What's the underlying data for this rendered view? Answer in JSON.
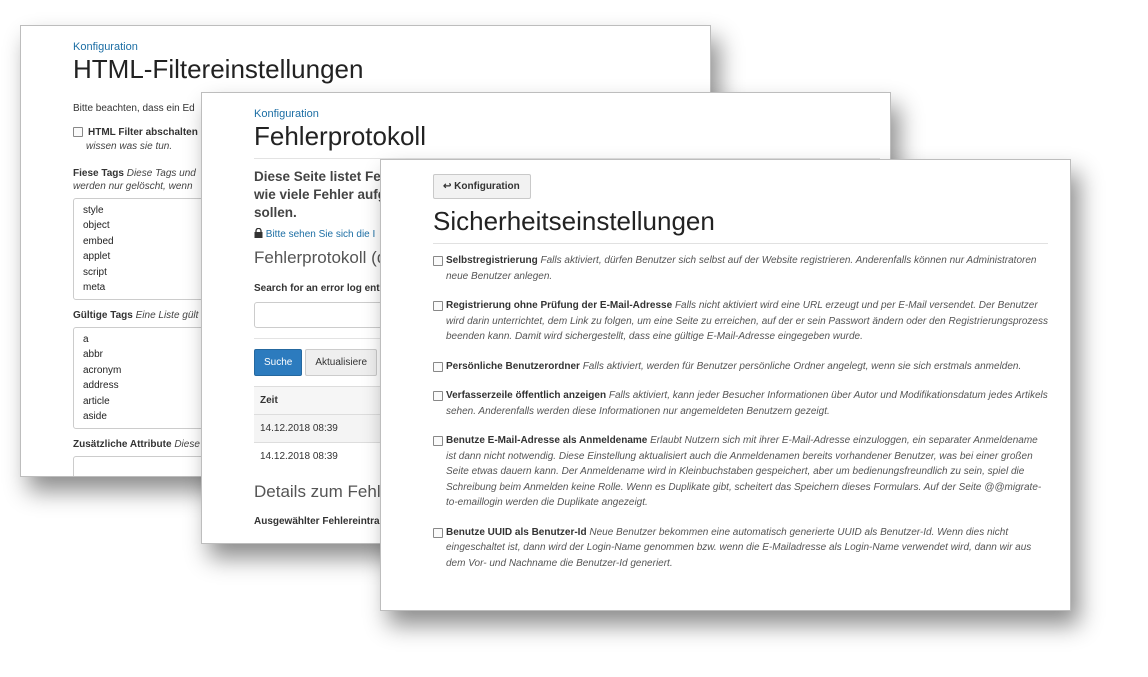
{
  "win1": {
    "breadcrumb": "Konfiguration",
    "title": "HTML-Filtereinstellungen",
    "note": "Bitte beachten, dass ein Ed",
    "disable_filter_label": "HTML Filter abschalten",
    "disable_filter_help": "wissen was sie tun.",
    "nasty_tags_label": "Fiese Tags",
    "nasty_tags_help": "Diese Tags und",
    "nasty_tags_help2": "werden nur gelöscht, wenn",
    "nasty_tags": [
      "style",
      "object",
      "embed",
      "applet",
      "script",
      "meta"
    ],
    "valid_tags_label": "Gültige Tags",
    "valid_tags_help": "Eine Liste gült",
    "valid_tags": [
      "a",
      "abbr",
      "acronym",
      "address",
      "article",
      "aside"
    ],
    "extra_attrs_label": "Zusätzliche Attribute",
    "extra_attrs_help": "Diese"
  },
  "win2": {
    "breadcrumb": "Konfiguration",
    "title": "Fehlerprotokoll",
    "intro_l1": "Diese Seite listet Feh",
    "intro_l2": "wie viele Fehler aufg",
    "intro_l3": "sollen.",
    "privacy_link": "Bitte sehen Sie sich die I",
    "section_title": "Fehlerprotokoll (di",
    "search_label": "Search for an error log ent",
    "search_button": "Suche",
    "refresh_button": "Aktualisiere",
    "table_header": "Zeit",
    "rows": [
      "14.12.2018 08:39",
      "14.12.2018 08:39"
    ],
    "details_title": "Details zum Fehler",
    "cutoff_text": "Ausgewählter Fehlereintrag"
  },
  "win3": {
    "back_button": "Konfiguration",
    "title": "Sicherheitseinstellungen",
    "settings": [
      {
        "label": "Selbstregistrierung",
        "help": "Falls aktiviert, dürfen Benutzer sich selbst auf der Website registrieren. Anderenfalls können nur Administratoren neue Benutzer anlegen."
      },
      {
        "label": "Registrierung ohne Prüfung der E-Mail-Adresse",
        "help": "Falls nicht aktiviert wird eine URL erzeugt und per E-Mail versendet. Der Benutzer wird darin unterrichtet, dem Link zu folgen, um eine Seite zu erreichen, auf der er sein Passwort ändern oder den Registrierungsprozess beenden kann. Damit wird sichergestellt, dass eine gültige E-Mail-Adresse eingegeben wurde."
      },
      {
        "label": "Persönliche Benutzerordner",
        "help": "Falls aktiviert, werden für Benutzer persönliche Ordner angelegt, wenn sie sich erstmals anmelden."
      },
      {
        "label": "Verfasserzeile öffentlich anzeigen",
        "help": "Falls aktiviert, kann jeder Besucher Informationen über Autor und Modifikationsdatum jedes Artikels sehen. Anderenfalls werden diese Informationen nur angemeldeten Benutzern gezeigt."
      },
      {
        "label": "Benutze E-Mail-Adresse als Anmeldename",
        "help": "Erlaubt Nutzern sich mit ihrer E-Mail-Adresse einzuloggen, ein separater Anmeldename ist dann nicht notwendig. Diese Einstellung aktualisiert auch die Anmeldenamen bereits vorhandener Benutzer, was bei einer großen Seite etwas dauern kann. Der Anmeldename wird in Kleinbuchstaben gespeichert, aber um bedienungsfreundlich zu sein, spiel die Schreibung beim Anmelden keine Rolle. Wenn es Duplikate gibt, scheitert das Speichern dieses Formulars. Auf der Seite @@migrate-to-emaillogin werden die Duplikate angezeigt."
      },
      {
        "label": "Benutze UUID als Benutzer-Id",
        "help": "Neue Benutzer bekommen eine automatisch generierte UUID als Benutzer-Id. Wenn dies nicht eingeschaltet ist, dann wird der Login-Name genommen bzw. wenn die E-Mailadresse als Login-Name verwendet wird, dann wir aus dem Vor- und Nachname die Benutzer-Id generiert."
      }
    ]
  }
}
